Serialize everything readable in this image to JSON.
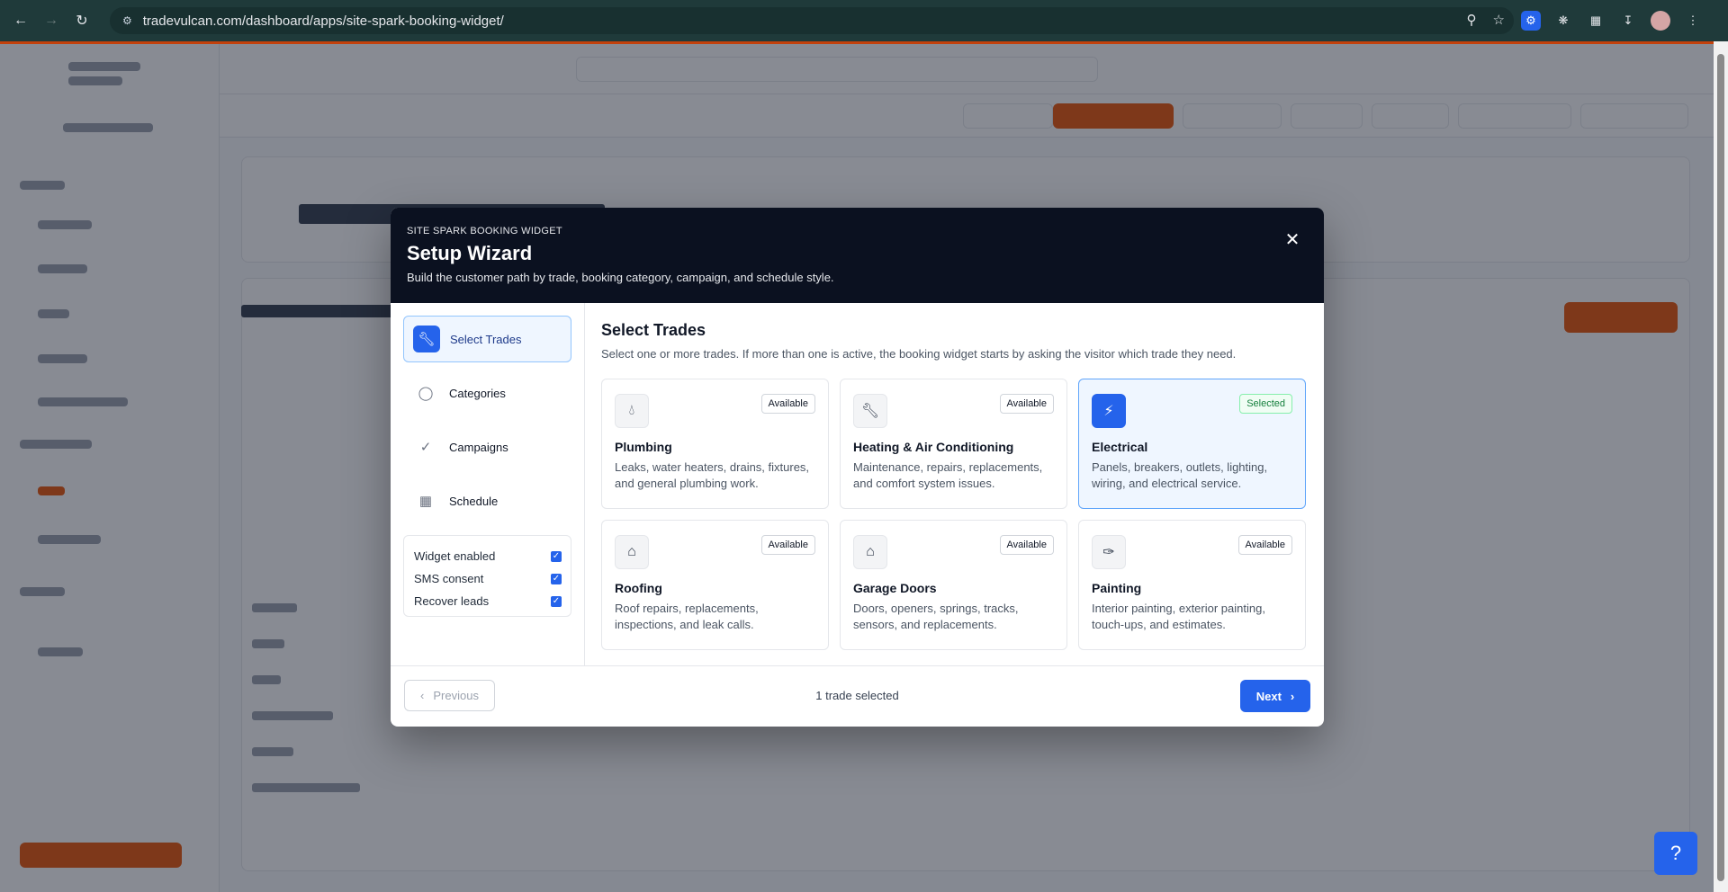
{
  "browser": {
    "url": "tradevulcan.com/dashboard/apps/site-spark-booking-widget/",
    "icons": [
      "back-icon",
      "forward-icon",
      "reload-icon",
      "site-info-icon",
      "zoom-icon",
      "bookmark-star-icon",
      "extension-icon",
      "download-icon",
      "profile-avatar",
      "menu-icon"
    ]
  },
  "modal": {
    "eyebrow": "SITE SPARK BOOKING WIDGET",
    "title": "Setup Wizard",
    "subtitle": "Build the customer path by trade, booking category, campaign, and schedule style.",
    "close_icon": "close-icon",
    "steps": [
      {
        "label": "Select Trades",
        "icon": "wrench-icon",
        "active": true
      },
      {
        "label": "Categories",
        "icon": "tag-icon",
        "active": false
      },
      {
        "label": "Campaigns",
        "icon": "check-icon",
        "active": false
      },
      {
        "label": "Schedule",
        "icon": "calendar-icon",
        "active": false
      }
    ],
    "toggles": [
      {
        "label": "Widget enabled",
        "checked": true
      },
      {
        "label": "SMS consent",
        "checked": true
      },
      {
        "label": "Recover leads",
        "checked": true
      }
    ],
    "content": {
      "title": "Select Trades",
      "subtitle": "Select one or more trades. If more than one is active, the booking widget starts by asking the visitor which trade they need.",
      "trades": [
        {
          "name": "Plumbing",
          "desc": "Leaks, water heaters, drains, fixtures, and general plumbing work.",
          "status": "Available",
          "icon": "droplet-icon",
          "selected": false
        },
        {
          "name": "Heating & Air Conditioning",
          "desc": "Maintenance, repairs, replacements, and comfort system issues.",
          "status": "Available",
          "icon": "wrench-icon",
          "selected": false
        },
        {
          "name": "Electrical",
          "desc": "Panels, breakers, outlets, lighting, wiring, and electrical service.",
          "status": "Selected",
          "icon": "lightning-icon",
          "selected": true
        },
        {
          "name": "Roofing",
          "desc": "Roof repairs, replacements, inspections, and leak calls.",
          "status": "Available",
          "icon": "house-icon",
          "selected": false
        },
        {
          "name": "Garage Doors",
          "desc": "Doors, openers, springs, tracks, sensors, and replacements.",
          "status": "Available",
          "icon": "house-icon",
          "selected": false
        },
        {
          "name": "Painting",
          "desc": "Interior painting, exterior painting, touch-ups, and estimates.",
          "status": "Available",
          "icon": "paintbrush-icon",
          "selected": false
        }
      ]
    },
    "footer": {
      "previous_label": "Previous",
      "status": "1 trade selected",
      "next_label": "Next"
    }
  },
  "help_icon": "help-question-icon",
  "colors": {
    "primary": "#2563eb",
    "header_dark": "#0b1120",
    "accent_orange": "#ea580c",
    "selected_green": "#15803d"
  }
}
